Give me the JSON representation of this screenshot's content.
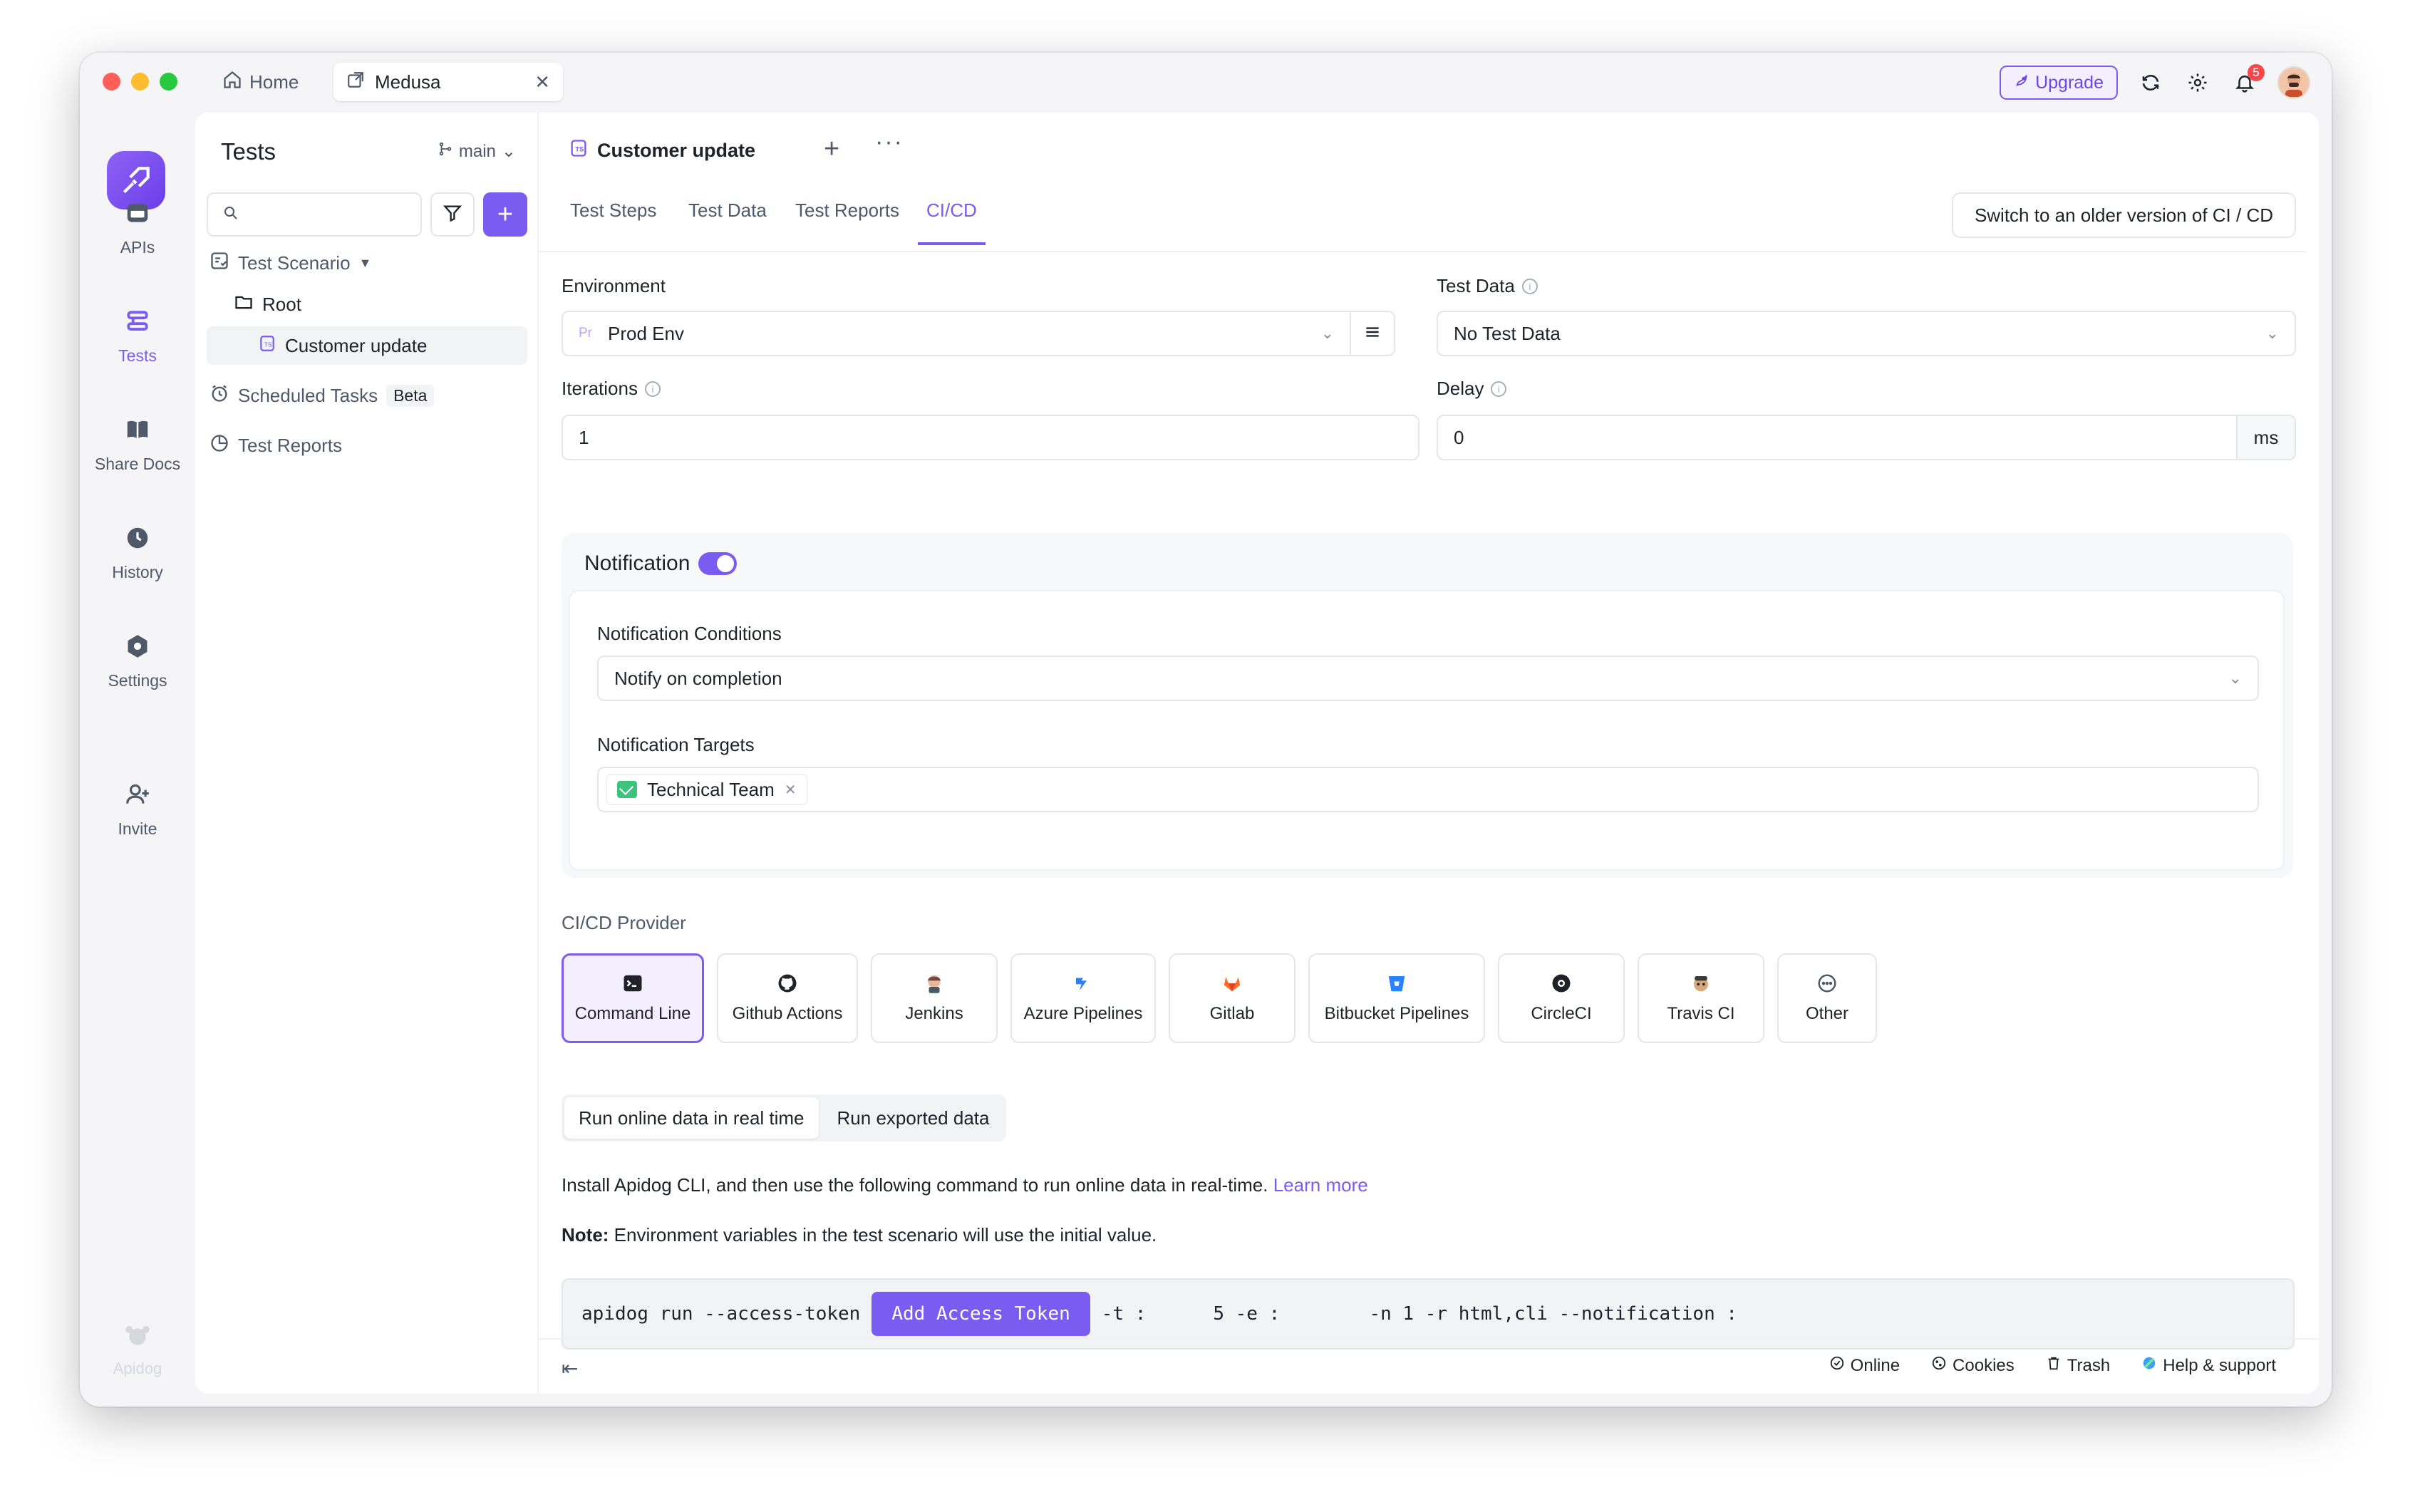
{
  "titlebar": {
    "tabs": [
      {
        "label": "Home",
        "icon": "home-icon"
      },
      {
        "label": "Medusa",
        "icon": "external-tab-icon"
      }
    ],
    "upgrade_label": "Upgrade",
    "notification_count": "5"
  },
  "rail": {
    "items": [
      {
        "label": "APIs",
        "icon": "api-icon"
      },
      {
        "label": "Tests",
        "icon": "tests-icon"
      },
      {
        "label": "Share Docs",
        "icon": "book-icon"
      },
      {
        "label": "History",
        "icon": "history-icon"
      },
      {
        "label": "Settings",
        "icon": "settings-icon"
      },
      {
        "label": "Invite",
        "icon": "invite-icon"
      }
    ],
    "footer_label": "Apidog"
  },
  "sidebar": {
    "title": "Tests",
    "branch": "main",
    "search_placeholder": "",
    "tree": {
      "scenario_label": "Test Scenario",
      "root_label": "Root",
      "selected_label": "Customer update",
      "scheduled_label": "Scheduled Tasks",
      "scheduled_badge": "Beta",
      "reports_label": "Test Reports"
    }
  },
  "content": {
    "doc_tab_label": "Customer update",
    "subtabs": [
      "Test Steps",
      "Test Data",
      "Test Reports",
      "CI/CD"
    ],
    "active_subtab": "CI/CD",
    "older_version_label": "Switch to an older version of CI / CD",
    "environment": {
      "label": "Environment",
      "prefix": "Pr",
      "value": "Prod Env"
    },
    "test_data": {
      "label": "Test Data",
      "value": "No Test Data"
    },
    "iterations": {
      "label": "Iterations",
      "value": "1"
    },
    "delay": {
      "label": "Delay",
      "value": "0",
      "unit": "ms"
    },
    "notification": {
      "title": "Notification",
      "enabled": true,
      "conditions_label": "Notification Conditions",
      "conditions_value": "Notify on completion",
      "targets_label": "Notification Targets",
      "target_tag": "Technical Team"
    },
    "provider": {
      "label": "CI/CD Provider",
      "items": [
        {
          "label": "Command Line",
          "icon": "terminal-icon"
        },
        {
          "label": "Github Actions",
          "icon": "github-icon"
        },
        {
          "label": "Jenkins",
          "icon": "jenkins-icon"
        },
        {
          "label": "Azure Pipelines",
          "icon": "azure-icon"
        },
        {
          "label": "Gitlab",
          "icon": "gitlab-icon"
        },
        {
          "label": "Bitbucket Pipelines",
          "icon": "bitbucket-icon"
        },
        {
          "label": "CircleCI",
          "icon": "circleci-icon"
        },
        {
          "label": "Travis CI",
          "icon": "travis-icon"
        },
        {
          "label": "Other",
          "icon": "more-circle-icon"
        }
      ],
      "selected": "Command Line"
    },
    "run_tabs": [
      "Run online data in real time",
      "Run exported data"
    ],
    "install_text": "Install Apidog CLI, and then use the following command to run online data in real-time.",
    "learn_more": "Learn more",
    "note_bold": "Note:",
    "note_text": " Environment variables in the test scenario will use the initial value.",
    "command": {
      "prefix": "apidog run --access-token",
      "token_button": "Add Access Token",
      "suffix": "-t :      5 -e :        -n 1 -r html,cli --notification :"
    }
  },
  "footer": {
    "links": [
      "Online",
      "Cookies",
      "Trash",
      "Help & support"
    ]
  },
  "colors": {
    "accent": "#7b5cf0",
    "toggle_on": "#7b5cf0"
  }
}
